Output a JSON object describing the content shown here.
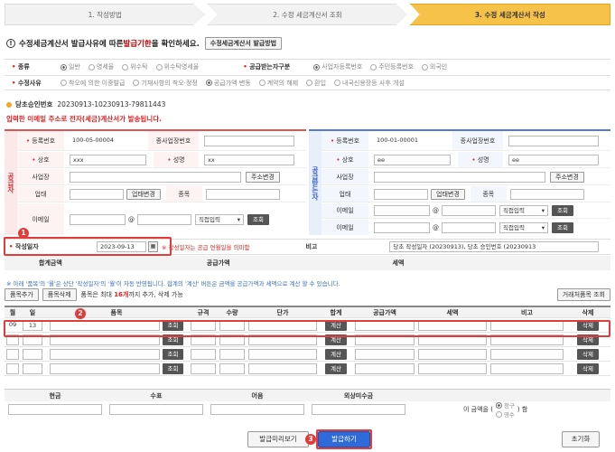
{
  "steps": [
    "1. 작성방법",
    "2. 수정 세금계산서 조회",
    "3. 수정 세금계산서 작성"
  ],
  "notice": {
    "pre": "수정세금계산서 발급사유에 따른 ",
    "highlight": "발급기한",
    "post": "을 확인하세요.",
    "button": "수정세금계산서 발급방법"
  },
  "kind": {
    "label": "종류",
    "options": [
      "일반",
      "영세율",
      "위수탁",
      "위수탁영세율"
    ],
    "selected": 0
  },
  "receiver": {
    "label": "공급받는자구분",
    "options": [
      "사업자등록번호",
      "주민등록번호",
      "외국인"
    ],
    "selected": 0
  },
  "reason": {
    "label": "수정사유",
    "options": [
      "착오에 의한 이중발급",
      "기재사항의 착오·정정",
      "공급가액 변동",
      "계약의 해제",
      "환입",
      "내국신용장등 사후 개설"
    ],
    "selected": 2
  },
  "approval": {
    "label": "당초승인번호",
    "value": "20230913-10230913-79811443"
  },
  "warning": "입력한 이메일 주소로 전자(세금)계산서가 발송됩니다.",
  "supplier": {
    "side": "공급자",
    "reg_label": "등록번호",
    "reg_value": "100-05-00004",
    "branch_label": "종사업장번호",
    "name_label": "상호",
    "name_value": "xxx",
    "ceo_label": "성명",
    "ceo_value": "xx",
    "addr_label": "사업장",
    "addr_btn": "주소변경",
    "biz_label": "업태",
    "biz_btn": "업태변경",
    "item_label": "종목",
    "email_label": "이메일",
    "email_at": "@",
    "email_select": "직접입력",
    "email_btn": "조회"
  },
  "buyer": {
    "side": "공급받는자",
    "reg_label": "등록번호",
    "reg_value": "100-01-00001",
    "branch_label": "종사업장번호",
    "name_label": "상호",
    "name_value": "ee",
    "ceo_label": "성명",
    "ceo_value": "ee",
    "addr_label": "사업장",
    "addr_btn": "주소변경",
    "biz_label": "업태",
    "biz_btn": "업태변경",
    "item_label": "종목",
    "email_label": "이메일",
    "email_at": "@",
    "email_select": "직접입력",
    "email_btn": "조회"
  },
  "date_row": {
    "label": "작성일자",
    "value": "2023-09-13",
    "note": "작성일자는 공급 연월일을 의미함",
    "remark_label": "비고",
    "remark_value": "당초 작성일자 (20230913), 당초 승인번호 (20230913"
  },
  "sum_row": {
    "total": "합계금액",
    "supply": "공급가액",
    "tax": "세액"
  },
  "note2": "※ 아래 '품목'의 '월'은 상단 '작성일자'의 '월'이 자동 반영됩니다. 합계의 '계산' 버튼은 금액을 공급가액과 세액으로 계산 할 수 있습니다.",
  "toolbar": {
    "add": "품목추가",
    "del": "품목삭제",
    "info_pre": "품목은 최대 ",
    "info_hl": "16개",
    "info_post": "까지 추가, 삭제 가능",
    "right": "거래처품목 조회"
  },
  "grid": {
    "headers": [
      "월",
      "일",
      "품목",
      "규격",
      "수량",
      "단가",
      "합계",
      "공급가액",
      "세액",
      "비고",
      "삭제"
    ],
    "first_month": "09",
    "first_day": "13",
    "search_btn": "조회",
    "calc_btn": "계산",
    "del_btn": "삭제"
  },
  "payment": {
    "headers": [
      "현금",
      "수표",
      "어음",
      "외상미수금"
    ],
    "amount_pre": "이 금액을 (",
    "claim": "청구",
    "receipt": "영수",
    "amount_post": ") 함"
  },
  "bottom": {
    "preview": "발급미리보기",
    "issue": "발급하기",
    "reset": "초기화"
  },
  "badges": [
    "1",
    "2",
    "3"
  ]
}
